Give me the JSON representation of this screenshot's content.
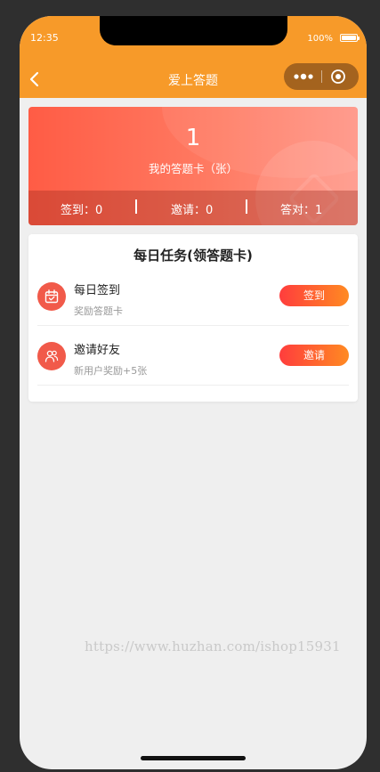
{
  "status_bar": {
    "time": "12:35",
    "battery": "100%"
  },
  "nav": {
    "title": "爱上答题"
  },
  "stats_card": {
    "count": "1",
    "label": "我的答题卡（张）",
    "stats": [
      {
        "label": "签到：",
        "value": "0"
      },
      {
        "label": "邀请：",
        "value": "0"
      },
      {
        "label": "答对：",
        "value": "1"
      }
    ]
  },
  "tasks": {
    "title": "每日任务(领答题卡)",
    "items": [
      {
        "name": "每日签到",
        "desc": "奖励答题卡",
        "button": "签到",
        "icon": "calendar-icon"
      },
      {
        "name": "邀请好友",
        "desc": "新用户奖励+5张",
        "button": "邀请",
        "icon": "users-icon"
      }
    ]
  },
  "watermark": "https://www.huzhan.com/ishop15931",
  "colors": {
    "header": "#f79a29",
    "accent_red": "#f15a4a",
    "button_gradient_start": "#ff3d3d",
    "button_gradient_end": "#ff8a22"
  }
}
